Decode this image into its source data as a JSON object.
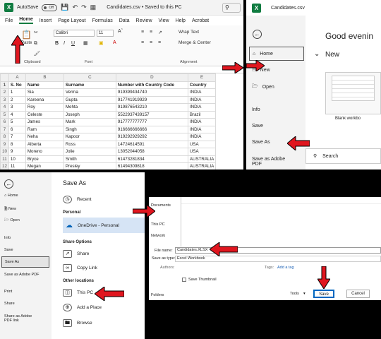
{
  "excel": {
    "autosave_label": "AutoSave",
    "toggle_state": "Off",
    "doc_title": "Candidates.csv • Saved to this PC",
    "menu": [
      "File",
      "Home",
      "Insert",
      "Page Layout",
      "Formulas",
      "Data",
      "Review",
      "View",
      "Help",
      "Acrobat"
    ],
    "font_name": "Calibri",
    "font_size": "11",
    "wrap_text": "Wrap Text",
    "merge_center": "Merge & Center",
    "groups": {
      "clipboard": "Clipboard",
      "font": "Font",
      "alignment": "Alignment"
    },
    "paste_label": "Paste",
    "columns": [
      "A",
      "B",
      "C",
      "D",
      "E"
    ],
    "rows": [
      [
        "S. No",
        "Name",
        "Surname",
        "Number with Country Code",
        "Country"
      ],
      [
        "1",
        "Sia",
        "Verma",
        "919399434740",
        "INDIA"
      ],
      [
        "2",
        "Kareena",
        "Gupta",
        "917741919929",
        "INDIA"
      ],
      [
        "3",
        "Roy",
        "Mehta",
        "919876543210",
        "INDIA"
      ],
      [
        "4",
        "Celeste",
        "Joseph",
        "5522937439157",
        "Brazil"
      ],
      [
        "5",
        "James",
        "Mark",
        "917777777777",
        "INDIA"
      ],
      [
        "6",
        "Ram",
        "Singh",
        "916666666666",
        "INDIA"
      ],
      [
        "7",
        "Neha",
        "Kapoor",
        "919292929292",
        "INDIA"
      ],
      [
        "8",
        "Alberta",
        "Ross",
        "14724614591",
        "USA"
      ],
      [
        "9",
        "Moreno",
        "Jolie",
        "13052044058",
        "USA"
      ],
      [
        "10",
        "Bryce",
        "Smith",
        "61473281834",
        "AUSTRALIA"
      ],
      [
        "11",
        "Megan",
        "Presley",
        "61494309818",
        "AUSTRALIA"
      ],
      [
        "",
        "",
        "",
        "",
        ""
      ]
    ]
  },
  "backstage": {
    "title": "Candidates.csv",
    "greeting": "Good evenin",
    "new_heading": "New",
    "blank_workbook": "Blank workbo",
    "search_label": "Search",
    "items": [
      "Home",
      "New",
      "Open",
      "Info",
      "Save",
      "Save As",
      "Save as Adobe PDF"
    ]
  },
  "saveas": {
    "side_items": [
      "Home",
      "New",
      "Open",
      "Info",
      "Save",
      "Save As",
      "Save as Adobe PDF",
      "Print",
      "Share",
      "Share as Adobe PDF link"
    ],
    "heading": "Save As",
    "recent": "Recent",
    "personal": "Personal",
    "onedrive": "OneDrive - Personal",
    "share_options": "Share Options",
    "share": "Share",
    "copy_link": "Copy Link",
    "other_locations": "Other locations",
    "this_pc": "This PC",
    "add_place": "Add a Place",
    "browse": "Browse"
  },
  "dialog": {
    "nav_items": [
      "Documents",
      "This PC",
      "Network"
    ],
    "file_name_label": "File name:",
    "file_name": "Candidates.XLSX",
    "save_type_label": "Save as type:",
    "save_type": "Excel Workbook",
    "authors_label": "Authors:",
    "tags_label": "Tags:",
    "tags_value": "Add a tag",
    "save_thumbnail": "Save Thumbnail",
    "hide_folders": "Folders",
    "tools": "Tools",
    "save": "Save",
    "cancel": "Cancel"
  },
  "colors": {
    "excel_green": "#107c41",
    "arrow_red": "#e0161f",
    "selected_blue": "#d6e4f5"
  }
}
